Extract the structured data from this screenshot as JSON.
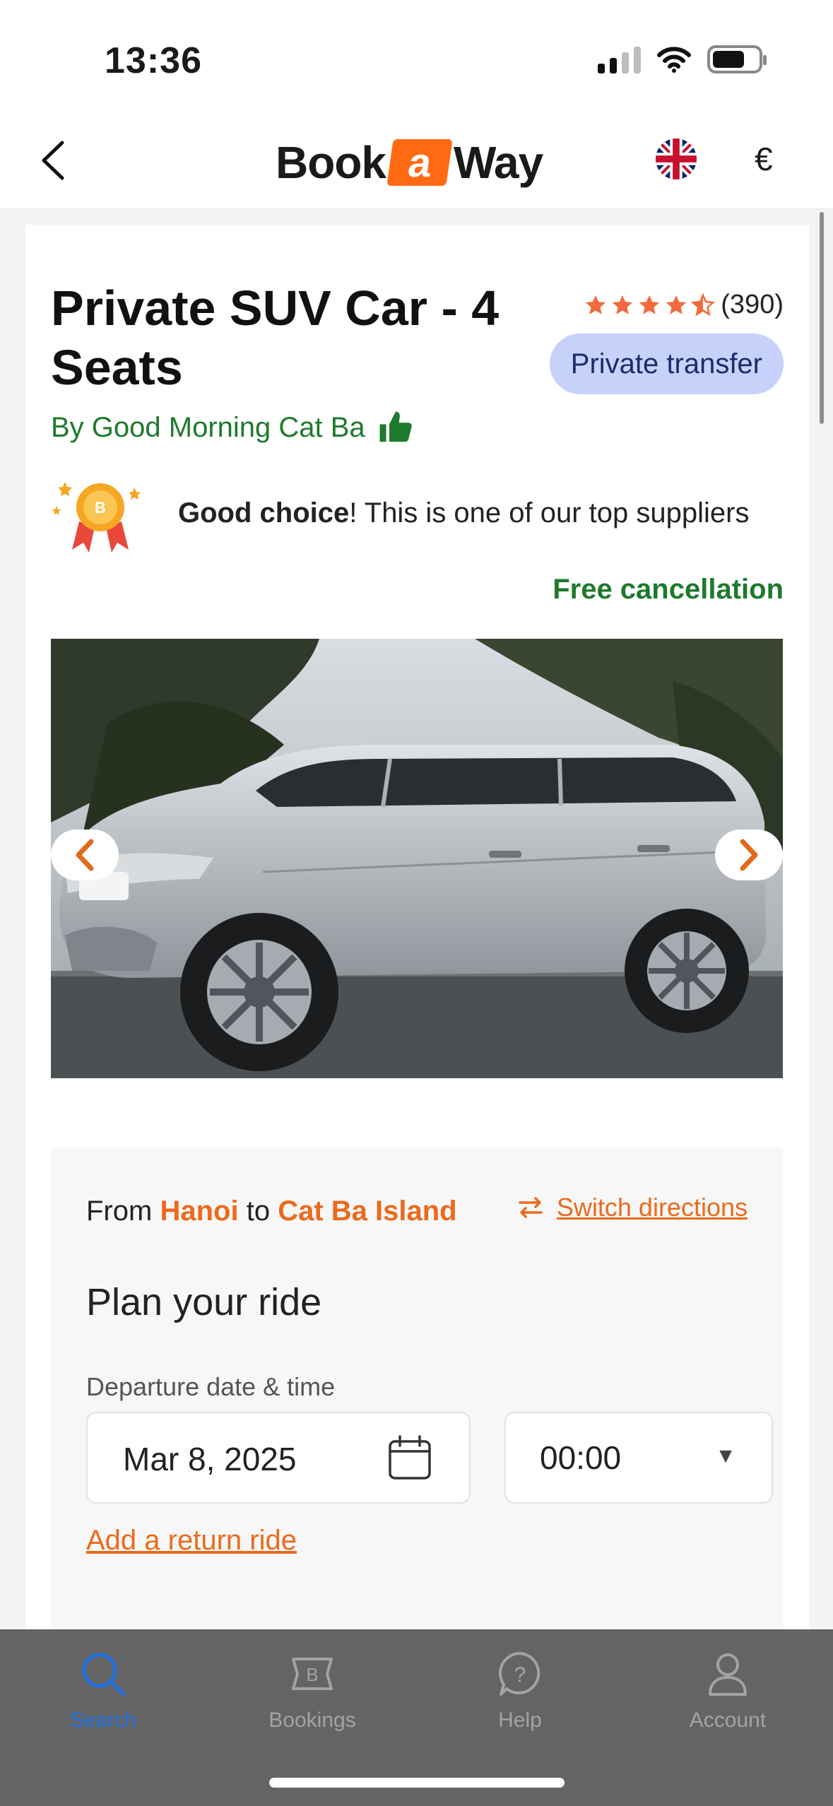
{
  "status_bar": {
    "time": "13:36"
  },
  "header": {
    "logo_left": "Book",
    "logo_mid": "a",
    "logo_right": "Way",
    "currency": "€"
  },
  "listing": {
    "title": "Private SUV Car - 4 Seats",
    "rating_count": "(390)",
    "rating_value": 4.5,
    "badge": "Private transfer",
    "supplier": "By Good Morning Cat Ba",
    "good_choice_bold": "Good choice",
    "good_choice_rest": "! This is one of our top suppliers",
    "free_cancellation": "Free cancellation"
  },
  "route": {
    "from_word": "From",
    "from_city": "Hanoi",
    "to_word": "to",
    "to_city": "Cat Ba Island",
    "switch_label": "Switch directions",
    "plan_title": "Plan your ride",
    "departure_label": "Departure date & time",
    "date_value": "Mar 8, 2025",
    "time_value": "00:00",
    "return_link": "Add a return ride"
  },
  "tabbar": {
    "tabs": [
      {
        "label": "Search",
        "active": true
      },
      {
        "label": "Bookings",
        "active": false
      },
      {
        "label": "Help",
        "active": false
      },
      {
        "label": "Account",
        "active": false
      }
    ]
  },
  "colors": {
    "brand_orange": "#ff6a13",
    "link_orange": "#ec6a1c",
    "green": "#1e7a2c",
    "badge_bg": "#c7d2fb",
    "active_tab": "#1e6fe0"
  }
}
